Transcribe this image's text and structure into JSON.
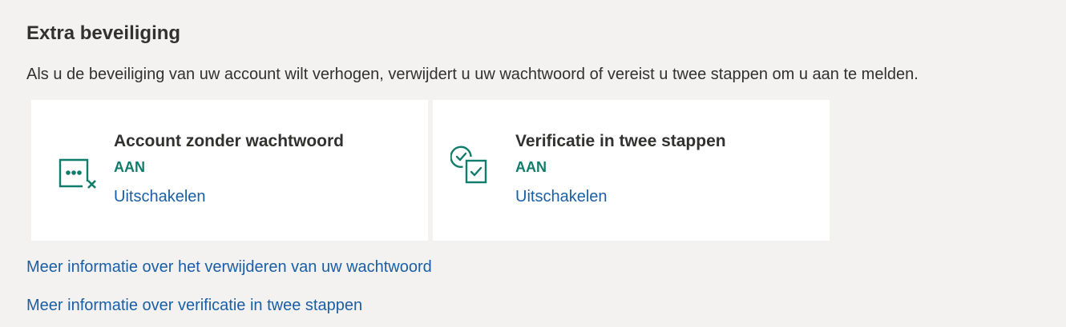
{
  "section": {
    "title": "Extra beveiliging",
    "description": "Als u de beveiliging van uw account wilt verhogen, verwijdert u uw wachtwoord of vereist u twee stappen om u aan te melden."
  },
  "cards": [
    {
      "icon": "passwordless-icon",
      "title": "Account zonder wachtwoord",
      "status": "AAN",
      "action": "Uitschakelen"
    },
    {
      "icon": "two-step-verification-icon",
      "title": "Verificatie in twee stappen",
      "status": "AAN",
      "action": "Uitschakelen"
    }
  ],
  "links": [
    "Meer informatie over het verwijderen van uw wachtwoord",
    "Meer informatie over verificatie in twee stappen"
  ],
  "colors": {
    "background": "#f3f2f1",
    "card": "#ffffff",
    "accent": "#107c6b",
    "link": "#1a5fa6",
    "text": "#323130"
  }
}
